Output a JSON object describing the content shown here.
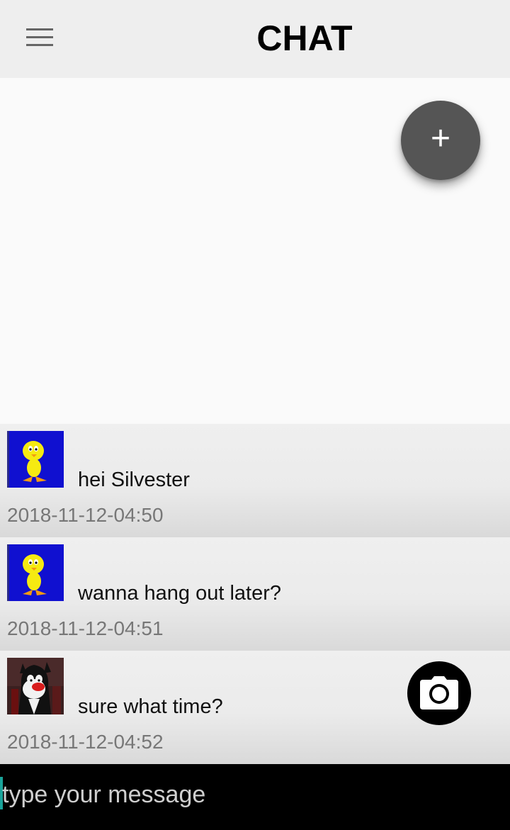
{
  "header": {
    "title": "CHAT",
    "menu_icon": "hamburger-menu-icon"
  },
  "fab": {
    "icon": "plus-icon",
    "glyph": "+"
  },
  "messages": [
    {
      "avatar": "tweety",
      "text": "hei Silvester",
      "timestamp": "2018-11-12-04:50"
    },
    {
      "avatar": "tweety",
      "text": "wanna hang out later?",
      "timestamp": "2018-11-12-04:51"
    },
    {
      "avatar": "sylvester",
      "text": "sure what time?",
      "timestamp": "2018-11-12-04:52"
    }
  ],
  "camera_button": {
    "icon": "camera-icon"
  },
  "composer": {
    "placeholder": "type your message",
    "value": ""
  },
  "colors": {
    "header_bg": "#eeeeee",
    "fab_bg": "#555555",
    "input_bar_bg": "#000000",
    "cursor": "#1aa39a",
    "avatar_tweety_bg": "#1010d0"
  }
}
